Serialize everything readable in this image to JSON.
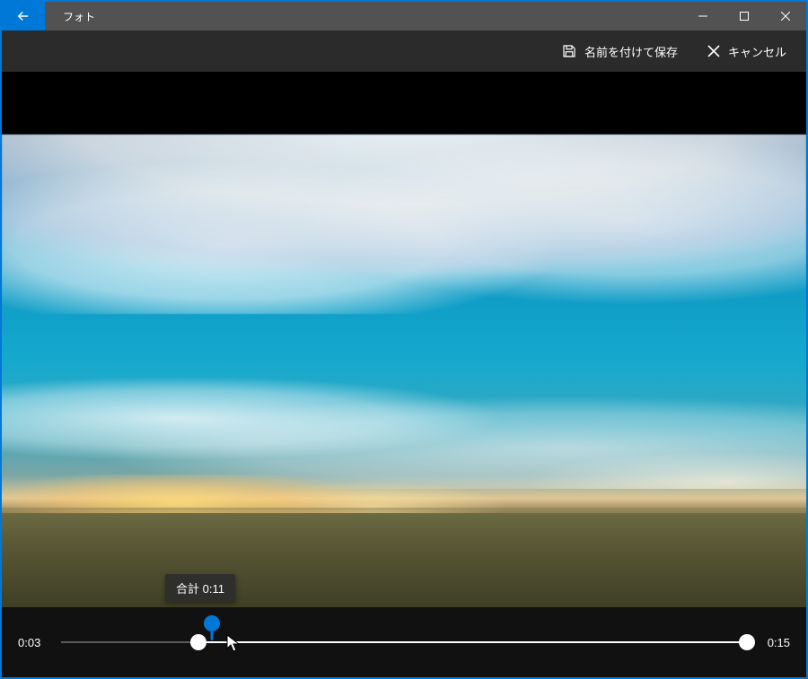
{
  "window": {
    "title": "フォト"
  },
  "toolbar": {
    "save_label": "名前を付けて保存",
    "cancel_label": "キャンセル"
  },
  "tooltip": {
    "total_label": "合計 0:11"
  },
  "trim": {
    "start_time": "0:03",
    "end_time": "0:15",
    "start_percent": 20,
    "end_percent": 100,
    "playhead_percent": 22
  },
  "colors": {
    "accent": "#0078d7"
  }
}
